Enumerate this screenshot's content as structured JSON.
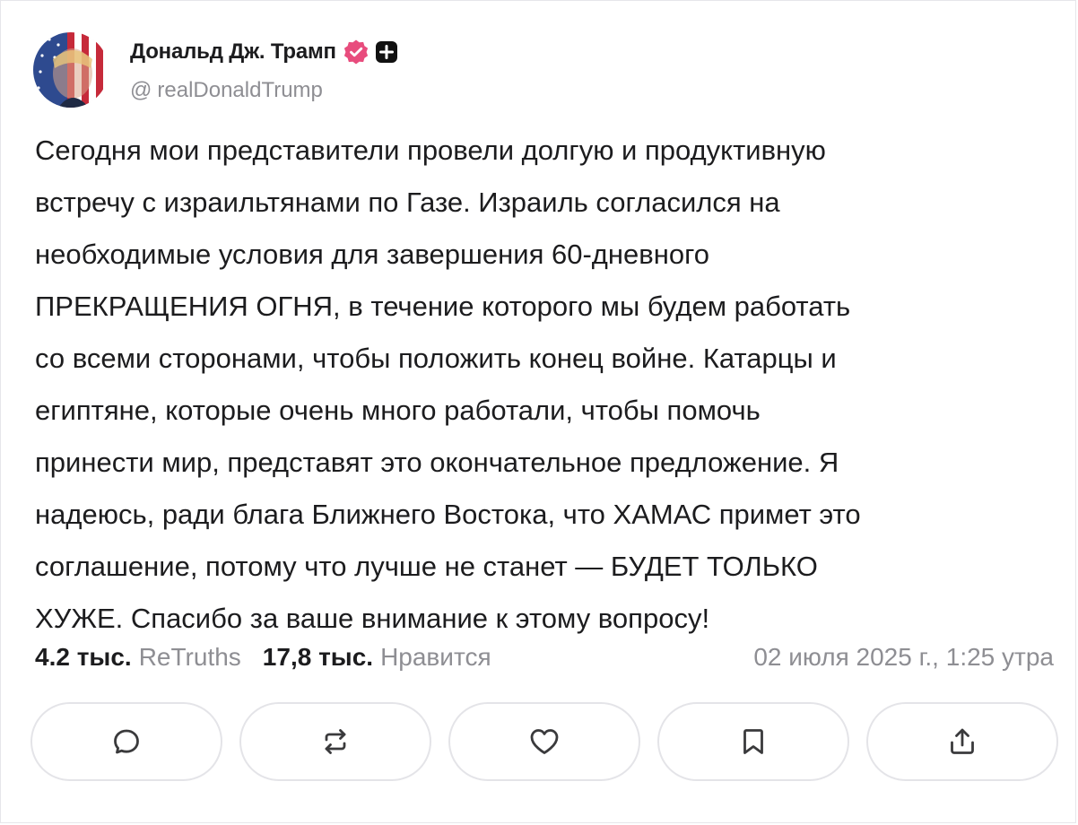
{
  "author": {
    "display_name": "Дональд Дж. Трамп",
    "handle_at": "@",
    "handle": "realDonaldTrump",
    "avatar_icon": "avatar-flag-portrait-icon",
    "verified_icon": "verified-badge-icon",
    "verified_color": "#e84c7d",
    "plus_icon": "plus-badge-icon"
  },
  "post": {
    "text": "Сегодня мои представители провели долгую и продуктивную\nвстречу с израильтянами по Газе. Израиль согласился на\nнеобходимые условия для завершения 60-дневного\nПРЕКРАЩЕНИЯ ОГНЯ, в течение которого мы будем работать\nсо всеми сторонами, чтобы положить конец войне. Катарцы и\nегиптяне, которые очень много работали, чтобы помочь\nпринести мир, представят это окончательное предложение. Я\nнадеюсь, ради блага Ближнего Востока, что ХАМАС примет это\nсоглашение, потому что лучше не станет — БУДЕТ ТОЛЬКО\nХУЖЕ. Спасибо за ваше внимание к этому вопросу!"
  },
  "stats": {
    "retruths_count": "4.2 тыс.",
    "retruths_label": "ReTruths",
    "likes_count": "17,8 тыс.",
    "likes_label": "Нравится",
    "timestamp": "02 июля 2025 г., 1:25 утра"
  },
  "actions": [
    {
      "icon": "reply-bubble-icon"
    },
    {
      "icon": "retruth-icon"
    },
    {
      "icon": "heart-icon"
    },
    {
      "icon": "bookmark-icon"
    },
    {
      "icon": "share-icon"
    }
  ],
  "colors": {
    "text": "#1c1c1e",
    "muted": "#8e8e93",
    "border": "#e4e4e8",
    "icon": "#3a3a3c"
  }
}
